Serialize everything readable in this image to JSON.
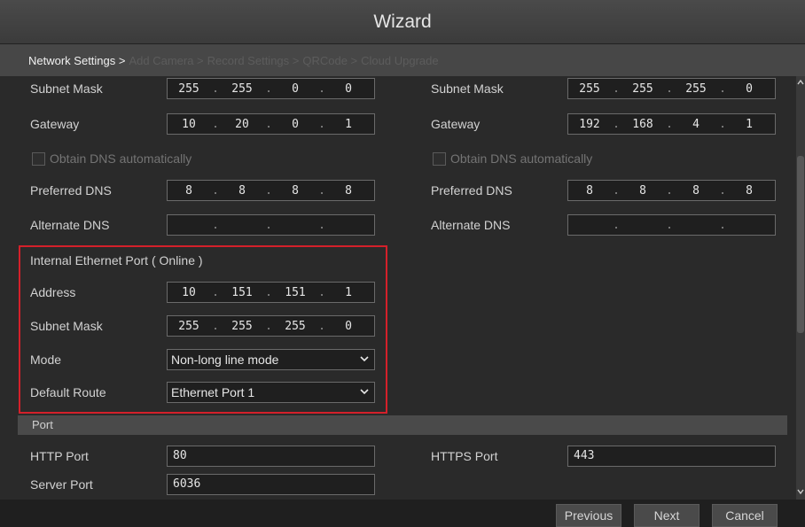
{
  "window": {
    "title": "Wizard"
  },
  "breadcrumb": {
    "items": [
      {
        "label": "Network Settings >",
        "state": "active"
      },
      {
        "label": "Add Camera >",
        "state": "inactive"
      },
      {
        "label": "Record Settings >",
        "state": "inactive"
      },
      {
        "label": "QRCode >",
        "state": "inactive"
      },
      {
        "label": "Cloud Upgrade",
        "state": "inactive"
      }
    ]
  },
  "left_column": {
    "subnet_mask": {
      "label": "Subnet Mask",
      "octets": [
        "255",
        "255",
        "0",
        "0"
      ]
    },
    "gateway": {
      "label": "Gateway",
      "octets": [
        "10",
        "20",
        "0",
        "1"
      ]
    },
    "obtain_dns": {
      "label": "Obtain DNS automatically",
      "checked": false
    },
    "preferred_dns": {
      "label": "Preferred DNS",
      "octets": [
        "8",
        "8",
        "8",
        "8"
      ]
    },
    "alternate_dns": {
      "label": "Alternate DNS",
      "octets": [
        "",
        "",
        "",
        ""
      ]
    }
  },
  "right_column": {
    "subnet_mask": {
      "label": "Subnet Mask",
      "octets": [
        "255",
        "255",
        "255",
        "0"
      ]
    },
    "gateway": {
      "label": "Gateway",
      "octets": [
        "192",
        "168",
        "4",
        "1"
      ]
    },
    "obtain_dns": {
      "label": "Obtain DNS automatically",
      "checked": false
    },
    "preferred_dns": {
      "label": "Preferred DNS",
      "octets": [
        "8",
        "8",
        "8",
        "8"
      ]
    },
    "alternate_dns": {
      "label": "Alternate DNS",
      "octets": [
        "",
        "",
        "",
        ""
      ]
    }
  },
  "internal_port": {
    "heading": "Internal Ethernet Port ( Online )",
    "address": {
      "label": "Address",
      "octets": [
        "10",
        "151",
        "151",
        "1"
      ]
    },
    "subnet_mask": {
      "label": "Subnet Mask",
      "octets": [
        "255",
        "255",
        "255",
        "0"
      ]
    },
    "mode": {
      "label": "Mode",
      "value": "Non-long line mode"
    },
    "default_route": {
      "label": "Default Route",
      "value": "Ethernet Port 1"
    }
  },
  "port_section": {
    "heading": "Port",
    "http_port": {
      "label": "HTTP Port",
      "value": "80"
    },
    "https_port": {
      "label": "HTTPS Port",
      "value": "443"
    },
    "server_port": {
      "label": "Server Port",
      "value": "6036"
    }
  },
  "footer": {
    "previous": "Previous",
    "next": "Next",
    "cancel": "Cancel"
  },
  "icons": {
    "dropdown": "chevron-down-icon",
    "scroll_up": "arrow-up-icon",
    "scroll_down": "arrow-down-icon"
  },
  "colors": {
    "highlight": "#d4202a",
    "background": "#2a2a2a"
  }
}
